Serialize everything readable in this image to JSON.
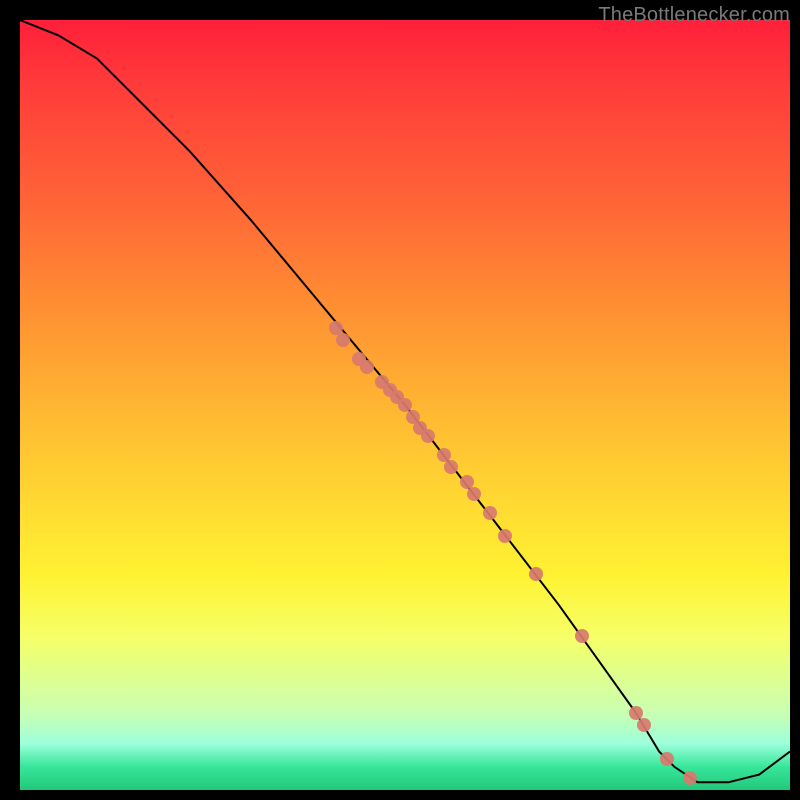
{
  "watermark": {
    "text": "TheBottlenecker.com"
  },
  "chart_data": {
    "type": "line",
    "title": "",
    "xlabel": "",
    "ylabel": "",
    "xlim": [
      0,
      100
    ],
    "ylim": [
      0,
      100
    ],
    "grid": false,
    "legend": false,
    "series": [
      {
        "name": "curve",
        "x": [
          0,
          5,
          10,
          15,
          22,
          30,
          40,
          50,
          60,
          70,
          75,
          80,
          83,
          85,
          88,
          92,
          96,
          100
        ],
        "values": [
          100,
          98,
          95,
          90,
          83,
          74,
          62,
          50,
          37,
          24,
          17,
          10,
          5,
          3,
          1,
          1,
          2,
          5
        ]
      }
    ],
    "points": [
      {
        "x": 41,
        "y": 60
      },
      {
        "x": 42,
        "y": 58.5
      },
      {
        "x": 44,
        "y": 56
      },
      {
        "x": 45,
        "y": 55
      },
      {
        "x": 47,
        "y": 53
      },
      {
        "x": 48,
        "y": 52
      },
      {
        "x": 49,
        "y": 51
      },
      {
        "x": 50,
        "y": 50
      },
      {
        "x": 51,
        "y": 48.5
      },
      {
        "x": 52,
        "y": 47
      },
      {
        "x": 53,
        "y": 46
      },
      {
        "x": 55,
        "y": 43.5
      },
      {
        "x": 56,
        "y": 42
      },
      {
        "x": 58,
        "y": 40
      },
      {
        "x": 59,
        "y": 38.5
      },
      {
        "x": 61,
        "y": 36
      },
      {
        "x": 63,
        "y": 33
      },
      {
        "x": 67,
        "y": 28
      },
      {
        "x": 73,
        "y": 20
      },
      {
        "x": 80,
        "y": 10
      },
      {
        "x": 81,
        "y": 8.5
      },
      {
        "x": 84,
        "y": 4
      },
      {
        "x": 87,
        "y": 1.5
      }
    ],
    "colors": {
      "curve": "#000000",
      "point": "#d87a6e"
    }
  }
}
